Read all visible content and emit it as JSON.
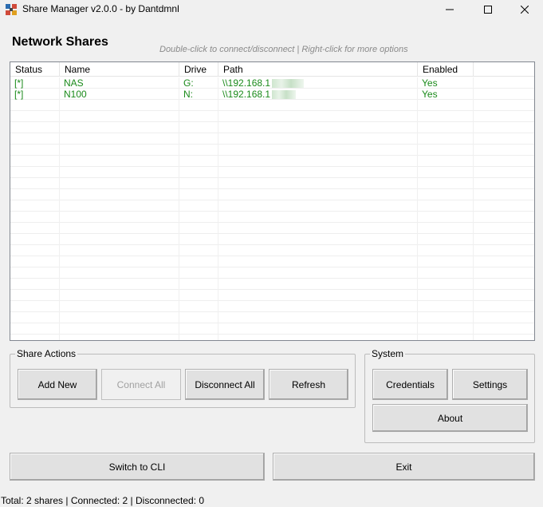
{
  "window": {
    "title": "Share Manager v2.0.0 - by Dantdmnl",
    "app_icon": "share-manager-app-icon",
    "controls": [
      "minimize-icon",
      "maximize-icon",
      "close-icon"
    ]
  },
  "header": {
    "title": "Network Shares",
    "hint": "Double-click to connect/disconnect | Right-click for more options"
  },
  "shares_list": {
    "columns": [
      "Status",
      "Name",
      "Drive",
      "Path",
      "Enabled"
    ],
    "rows": [
      {
        "status": "[*]",
        "name": "NAS",
        "drive": "G:",
        "path": "\\\\192.168.1",
        "enabled": "Yes"
      },
      {
        "status": "[*]",
        "name": "N100",
        "drive": "N:",
        "path": "\\\\192.168.1",
        "enabled": "Yes"
      }
    ],
    "row_color": "#1a8a1a"
  },
  "share_actions": {
    "legend": "Share Actions",
    "add_new": "Add New",
    "connect_all": "Connect All",
    "disconnect_all": "Disconnect All",
    "refresh": "Refresh"
  },
  "system": {
    "legend": "System",
    "credentials": "Credentials",
    "settings": "Settings",
    "about": "About"
  },
  "footer_buttons": {
    "switch_to_cli": "Switch to CLI",
    "exit": "Exit"
  },
  "status_bar": {
    "text": "Total: 2 shares | Connected: 2 | Disconnected: 0"
  }
}
